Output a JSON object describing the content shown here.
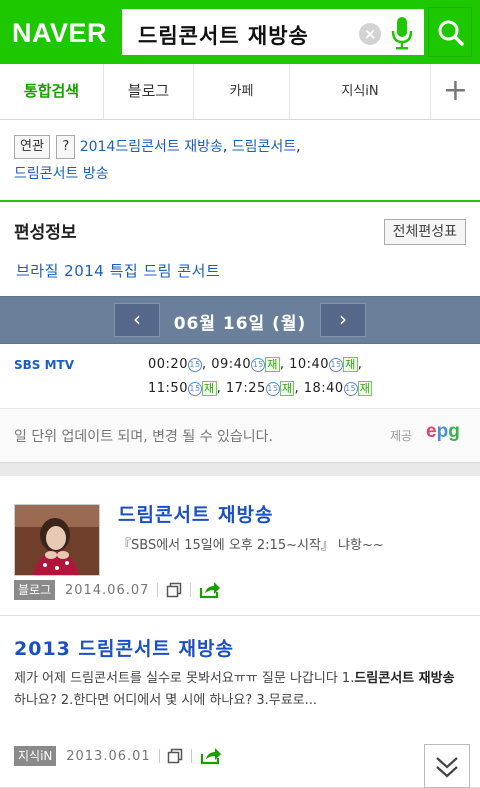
{
  "header": {
    "logo": "NAVER",
    "query": "드림콘서트 재방송",
    "clear_label": "×"
  },
  "tabs": [
    {
      "label": "통합검색",
      "active": true
    },
    {
      "label": "블로그"
    },
    {
      "label": "카페"
    },
    {
      "label": "지식iN"
    }
  ],
  "tabs_more": "+",
  "related": {
    "label": "연관",
    "help": "?",
    "links": [
      "2014드림콘서트 재방송",
      "드림콘서트",
      "드림콘서트 방송"
    ]
  },
  "schedule": {
    "title": "편성정보",
    "full_button": "전체편성표",
    "program": "브라질 2014 특집 드림 콘서트",
    "date": "06월 16일 (월)",
    "prev": "‹",
    "next": "›",
    "channel": "SBS MTV",
    "rows": [
      [
        {
          "time": "00:20"
        },
        {
          "time": "09:40",
          "re": true
        },
        {
          "time": "10:40",
          "re": true
        }
      ],
      [
        {
          "time": "11:50",
          "re": true
        },
        {
          "time": "17:25",
          "re": true
        },
        {
          "time": "18:40",
          "re": true
        }
      ]
    ],
    "age_mark": "15",
    "re_mark": "재",
    "notice": "일 단위 업데이트 되며, 변경 될 수 있습니다.",
    "provider_label": "제공",
    "provider_logo": "epg"
  },
  "results": [
    {
      "title": "드림콘서트 재방송",
      "snippet": "『SBS에서 15일에 오후 2:15~시작』 냐항~~",
      "badge": "블로그",
      "date": "2014.06.07"
    },
    {
      "title_prefix": "2013 ",
      "title": "드림콘서트 재방송",
      "snippet_a": "제가 어제 드림콘서트를 실수로 못봐서요ㅠㅠ 질문 나갑니다 1.",
      "snippet_b": "드림콘서트 재방송",
      "snippet_c": " 하나요? 2.한다면 어디에서 몇 시에 하나요? 3.무료로...",
      "badge": "지식iN",
      "date": "2013.06.01"
    }
  ],
  "colors": {
    "brand": "#1ec800",
    "link": "#1b5fc1",
    "datebar": "#6a7f99"
  }
}
